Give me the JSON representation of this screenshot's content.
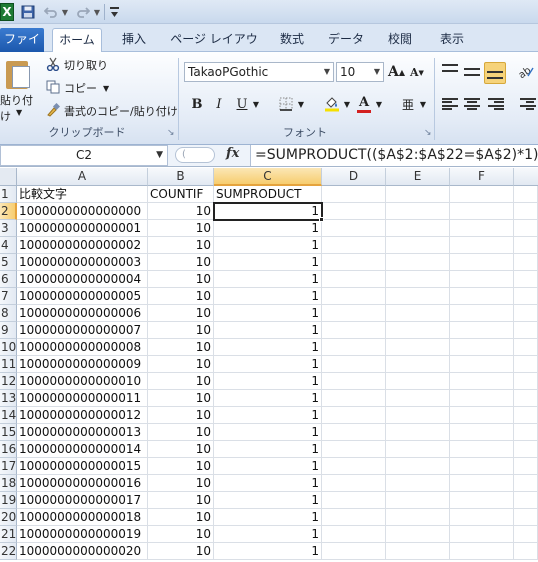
{
  "qat": {
    "app_icon": "X",
    "icons": [
      "excel-icon",
      "save-icon",
      "undo-icon",
      "redo-icon",
      "customize-icon"
    ]
  },
  "tabs": [
    {
      "label": "ファイル"
    },
    {
      "label": "ホーム"
    },
    {
      "label": "挿入"
    },
    {
      "label": "ページ レイアウト"
    },
    {
      "label": "数式"
    },
    {
      "label": "データ"
    },
    {
      "label": "校閲"
    },
    {
      "label": "表示"
    }
  ],
  "ribbon": {
    "clipboard": {
      "paste_label": "貼り付け",
      "cut_label": "切り取り",
      "copy_label": "コピー",
      "format_painter_label": "書式のコピー/貼り付け",
      "group_label": "クリップボード"
    },
    "font": {
      "font_name": "TakaoPGothic",
      "font_size": "10",
      "bold": "B",
      "italic": "I",
      "underline": "U",
      "grow": "A",
      "shrink": "A",
      "font_color_glyph": "A",
      "phonetic_glyph": "亜",
      "group_label": "フォント"
    }
  },
  "formula_bar": {
    "name_box": "C2",
    "fx": "fx",
    "formula": "=SUMPRODUCT(($A$2:$A$22=$A$2)*1)"
  },
  "sheet": {
    "columns": [
      "A",
      "B",
      "C",
      "D",
      "E",
      "F"
    ],
    "selected_column": "C",
    "selected_row": "2",
    "rows": [
      {
        "n": "1",
        "a": "比較文字",
        "b": "COUNTIF",
        "c": "SUMPRODUCT"
      },
      {
        "n": "2",
        "a": "1000000000000000",
        "b": "10",
        "c": "1"
      },
      {
        "n": "3",
        "a": "1000000000000001",
        "b": "10",
        "c": "1"
      },
      {
        "n": "4",
        "a": "1000000000000002",
        "b": "10",
        "c": "1"
      },
      {
        "n": "5",
        "a": "1000000000000003",
        "b": "10",
        "c": "1"
      },
      {
        "n": "6",
        "a": "1000000000000004",
        "b": "10",
        "c": "1"
      },
      {
        "n": "7",
        "a": "1000000000000005",
        "b": "10",
        "c": "1"
      },
      {
        "n": "8",
        "a": "1000000000000006",
        "b": "10",
        "c": "1"
      },
      {
        "n": "9",
        "a": "1000000000000007",
        "b": "10",
        "c": "1"
      },
      {
        "n": "10",
        "a": "1000000000000008",
        "b": "10",
        "c": "1"
      },
      {
        "n": "11",
        "a": "1000000000000009",
        "b": "10",
        "c": "1"
      },
      {
        "n": "12",
        "a": "1000000000000010",
        "b": "10",
        "c": "1"
      },
      {
        "n": "13",
        "a": "1000000000000011",
        "b": "10",
        "c": "1"
      },
      {
        "n": "14",
        "a": "1000000000000012",
        "b": "10",
        "c": "1"
      },
      {
        "n": "15",
        "a": "1000000000000013",
        "b": "10",
        "c": "1"
      },
      {
        "n": "16",
        "a": "1000000000000014",
        "b": "10",
        "c": "1"
      },
      {
        "n": "17",
        "a": "1000000000000015",
        "b": "10",
        "c": "1"
      },
      {
        "n": "18",
        "a": "1000000000000016",
        "b": "10",
        "c": "1"
      },
      {
        "n": "19",
        "a": "1000000000000017",
        "b": "10",
        "c": "1"
      },
      {
        "n": "20",
        "a": "1000000000000018",
        "b": "10",
        "c": "1"
      },
      {
        "n": "21",
        "a": "1000000000000019",
        "b": "10",
        "c": "1"
      },
      {
        "n": "22",
        "a": "1000000000000020",
        "b": "10",
        "c": "1"
      }
    ]
  },
  "colors": {
    "accent_header": "#f7cd6f",
    "file_tab": "#1c58ad",
    "excel_green": "#1e7b34",
    "font_color_bar": "#d32020",
    "fill_color_bar": "#f5e000"
  }
}
